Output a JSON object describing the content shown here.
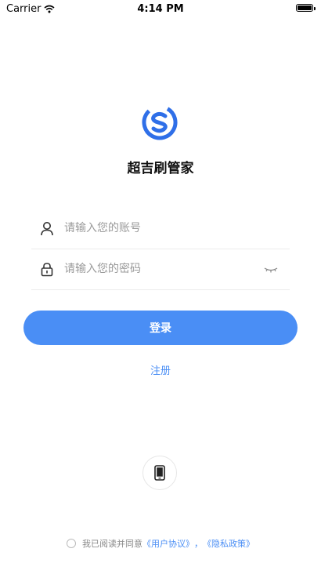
{
  "status_bar": {
    "carrier": "Carrier",
    "time": "4:14 PM"
  },
  "app": {
    "name": "超吉刷管家"
  },
  "login": {
    "account_placeholder": "请输入您的账号",
    "password_placeholder": "请输入您的密码",
    "login_label": "登录",
    "register_label": "注册"
  },
  "agreement": {
    "prefix": "我已阅读并同意",
    "user_agreement": "《用户协议》",
    "separator": "，",
    "privacy_policy": "《隐私政策》"
  },
  "colors": {
    "accent": "#4a8ef5",
    "logo": "#2f6fe8"
  }
}
